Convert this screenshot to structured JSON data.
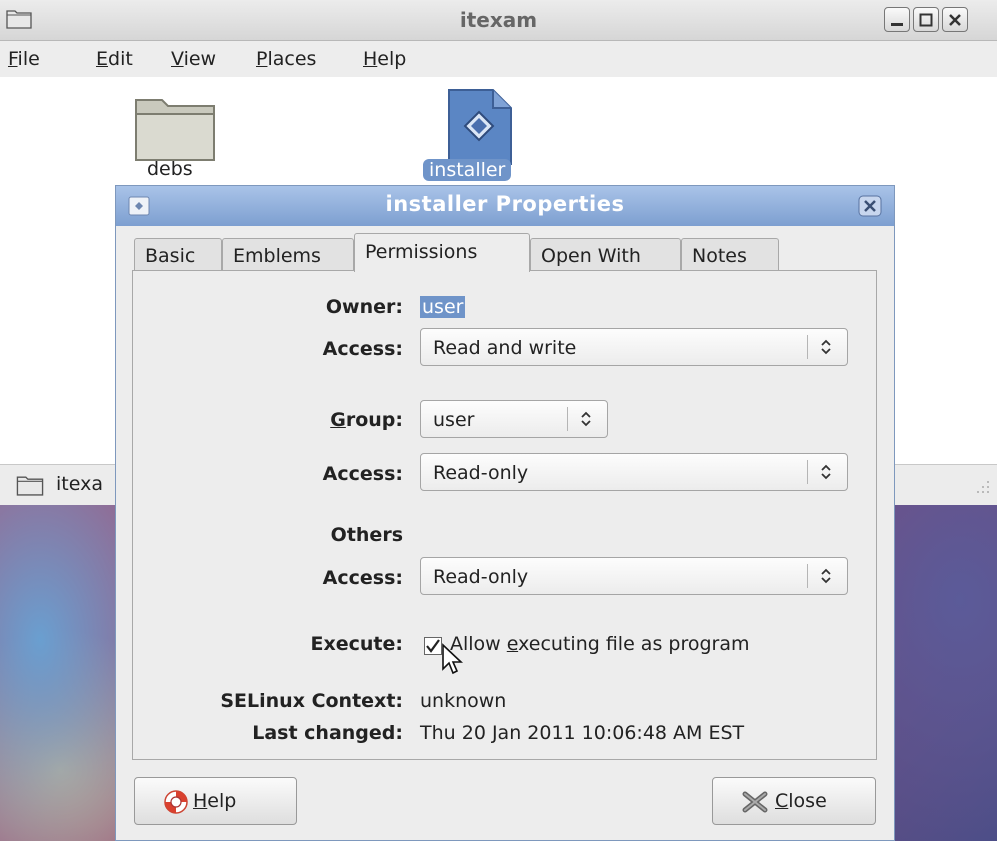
{
  "window": {
    "title": "itexam",
    "menu": [
      {
        "label": "File",
        "mnemonic": "F",
        "rest": "ile"
      },
      {
        "label": "Edit",
        "mnemonic": "E",
        "rest": "dit"
      },
      {
        "label": "View",
        "mnemonic": "V",
        "rest": "iew"
      },
      {
        "label": "Places",
        "mnemonic": "P",
        "rest": "laces"
      },
      {
        "label": "Help",
        "mnemonic": "H",
        "rest": "elp"
      }
    ],
    "files": [
      {
        "name": "debs",
        "icon": "folder-icon"
      },
      {
        "name": "installer",
        "icon": "executable-file-icon",
        "selected": true
      }
    ]
  },
  "taskbar": {
    "label": "itexa"
  },
  "dialog": {
    "title": "installer Properties",
    "tabs": [
      "Basic",
      "Emblems",
      "Permissions",
      "Open With",
      "Notes"
    ],
    "active_tab": "Permissions",
    "owner": {
      "label": "Owner:",
      "value": "user",
      "access_label": "Access:",
      "access": "Read and write"
    },
    "group": {
      "label_mnemonic": "G",
      "label_rest": "roup:",
      "value": "user",
      "access_label": "Access:",
      "access": "Read-only"
    },
    "others": {
      "label": "Others",
      "access_label": "Access:",
      "access": "Read-only"
    },
    "execute": {
      "label": "Execute:",
      "checked": true,
      "text_pre": "Allow ",
      "mnemonic": "e",
      "text_post": "xecuting file as program"
    },
    "selinux": {
      "label": "SELinux Context:",
      "value": "unknown"
    },
    "last_changed": {
      "label": "Last changed:",
      "value": "Thu 20 Jan 2011 10:06:48 AM EST"
    },
    "help_button": {
      "mnemonic": "H",
      "rest": "elp"
    },
    "close_button": {
      "mnemonic": "C",
      "rest": "lose"
    }
  },
  "colors": {
    "selection": "#6f94c9",
    "dialog_title": "#8fb0dd",
    "accent_blue": "#4a6fae"
  }
}
